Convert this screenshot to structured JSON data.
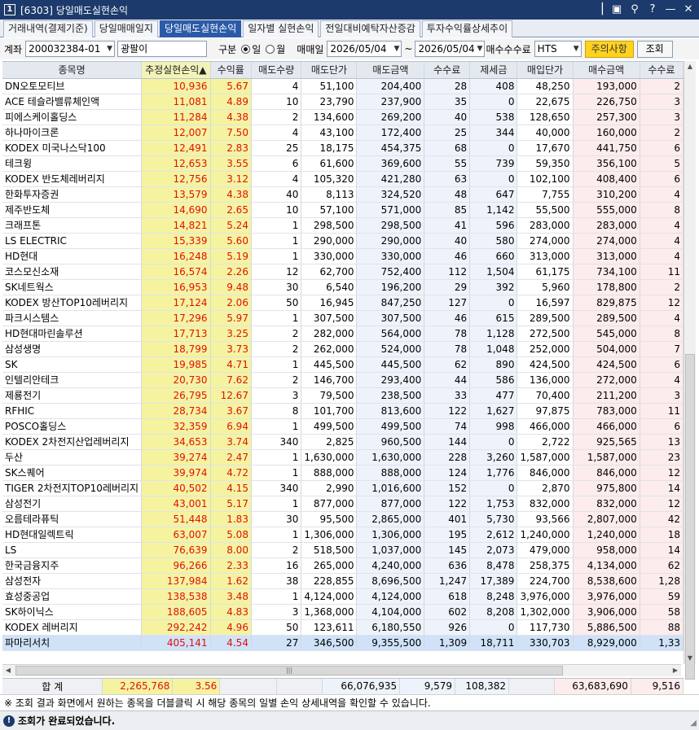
{
  "window": {
    "title": "[6303] 당일매도실현손익",
    "app_icon": "1",
    "controls": [
      "menu-icon",
      "save-icon",
      "filter-icon",
      "help-icon",
      "minimize-icon",
      "close-icon"
    ]
  },
  "tabs": [
    {
      "label": "거래내역(결제기준)",
      "active": false
    },
    {
      "label": "당일매매일지",
      "active": false
    },
    {
      "label": "당일매도실현손익",
      "active": true
    },
    {
      "label": "일자별 실현손익",
      "active": false
    },
    {
      "label": "전일대비예탁자산증감",
      "active": false
    },
    {
      "label": "투자수익률상세추이",
      "active": false
    }
  ],
  "toolbar": {
    "account_label": "계좌",
    "account_value": "200032384-01",
    "account_name": "광팔이",
    "type_label": "구분",
    "radio_day": "일",
    "radio_month": "월",
    "trade_date_label": "매매일",
    "date_from": "2026/05/04",
    "tilde": "~",
    "date_to": "2026/05/04",
    "fee_label": "매수수수료",
    "fee_value": "HTS",
    "notice_button": "주의사항",
    "query_button": "조회"
  },
  "columns": [
    "종목명",
    "추정실현손익▲",
    "수익률",
    "매도수량",
    "매도단가",
    "매도금액",
    "수수료",
    "제세금",
    "매입단가",
    "매수금액",
    "수수료"
  ],
  "rows": [
    [
      "DN오토모티브",
      "10,936",
      "5.67",
      "4",
      "51,100",
      "204,400",
      "28",
      "408",
      "48,250",
      "193,000",
      "2"
    ],
    [
      "ACE 테슬라밸류체인액",
      "11,081",
      "4.89",
      "10",
      "23,790",
      "237,900",
      "35",
      "0",
      "22,675",
      "226,750",
      "3"
    ],
    [
      "피에스케이홀딩스",
      "11,284",
      "4.38",
      "2",
      "134,600",
      "269,200",
      "40",
      "538",
      "128,650",
      "257,300",
      "3"
    ],
    [
      "하나마이크론",
      "12,007",
      "7.50",
      "4",
      "43,100",
      "172,400",
      "25",
      "344",
      "40,000",
      "160,000",
      "2"
    ],
    [
      "KODEX 미국나스닥100",
      "12,491",
      "2.83",
      "25",
      "18,175",
      "454,375",
      "68",
      "0",
      "17,670",
      "441,750",
      "6"
    ],
    [
      "테크윙",
      "12,653",
      "3.55",
      "6",
      "61,600",
      "369,600",
      "55",
      "739",
      "59,350",
      "356,100",
      "5"
    ],
    [
      "KODEX 반도체레버리지",
      "12,756",
      "3.12",
      "4",
      "105,320",
      "421,280",
      "63",
      "0",
      "102,100",
      "408,400",
      "6"
    ],
    [
      "한화투자증권",
      "13,579",
      "4.38",
      "40",
      "8,113",
      "324,520",
      "48",
      "647",
      "7,755",
      "310,200",
      "4"
    ],
    [
      "제주반도체",
      "14,690",
      "2.65",
      "10",
      "57,100",
      "571,000",
      "85",
      "1,142",
      "55,500",
      "555,000",
      "8"
    ],
    [
      "크래프톤",
      "14,821",
      "5.24",
      "1",
      "298,500",
      "298,500",
      "41",
      "596",
      "283,000",
      "283,000",
      "4"
    ],
    [
      "LS ELECTRIC",
      "15,339",
      "5.60",
      "1",
      "290,000",
      "290,000",
      "40",
      "580",
      "274,000",
      "274,000",
      "4"
    ],
    [
      "HD현대",
      "16,248",
      "5.19",
      "1",
      "330,000",
      "330,000",
      "46",
      "660",
      "313,000",
      "313,000",
      "4"
    ],
    [
      "코스모신소재",
      "16,574",
      "2.26",
      "12",
      "62,700",
      "752,400",
      "112",
      "1,504",
      "61,175",
      "734,100",
      "11"
    ],
    [
      "SK네트웍스",
      "16,953",
      "9.48",
      "30",
      "6,540",
      "196,200",
      "29",
      "392",
      "5,960",
      "178,800",
      "2"
    ],
    [
      "KODEX 방산TOP10레버리지",
      "17,124",
      "2.06",
      "50",
      "16,945",
      "847,250",
      "127",
      "0",
      "16,597",
      "829,875",
      "12"
    ],
    [
      "파크시스템스",
      "17,296",
      "5.97",
      "1",
      "307,500",
      "307,500",
      "46",
      "615",
      "289,500",
      "289,500",
      "4"
    ],
    [
      "HD현대마린솔루션",
      "17,713",
      "3.25",
      "2",
      "282,000",
      "564,000",
      "78",
      "1,128",
      "272,500",
      "545,000",
      "8"
    ],
    [
      "삼성생명",
      "18,799",
      "3.73",
      "2",
      "262,000",
      "524,000",
      "78",
      "1,048",
      "252,000",
      "504,000",
      "7"
    ],
    [
      "SK",
      "19,985",
      "4.71",
      "1",
      "445,500",
      "445,500",
      "62",
      "890",
      "424,500",
      "424,500",
      "6"
    ],
    [
      "인텔리안테크",
      "20,730",
      "7.62",
      "2",
      "146,700",
      "293,400",
      "44",
      "586",
      "136,000",
      "272,000",
      "4"
    ],
    [
      "제룡전기",
      "26,795",
      "12.67",
      "3",
      "79,500",
      "238,500",
      "33",
      "477",
      "70,400",
      "211,200",
      "3"
    ],
    [
      "RFHIC",
      "28,734",
      "3.67",
      "8",
      "101,700",
      "813,600",
      "122",
      "1,627",
      "97,875",
      "783,000",
      "11"
    ],
    [
      "POSCO홀딩스",
      "32,359",
      "6.94",
      "1",
      "499,500",
      "499,500",
      "74",
      "998",
      "466,000",
      "466,000",
      "6"
    ],
    [
      "KODEX 2차전지산업레버리지",
      "34,653",
      "3.74",
      "340",
      "2,825",
      "960,500",
      "144",
      "0",
      "2,722",
      "925,565",
      "13"
    ],
    [
      "두산",
      "39,274",
      "2.47",
      "1",
      "1,630,000",
      "1,630,000",
      "228",
      "3,260",
      "1,587,000",
      "1,587,000",
      "23"
    ],
    [
      "SK스퀘어",
      "39,974",
      "4.72",
      "1",
      "888,000",
      "888,000",
      "124",
      "1,776",
      "846,000",
      "846,000",
      "12"
    ],
    [
      "TIGER 2차전지TOP10레버리지",
      "40,502",
      "4.15",
      "340",
      "2,990",
      "1,016,600",
      "152",
      "0",
      "2,870",
      "975,800",
      "14"
    ],
    [
      "삼성전기",
      "43,001",
      "5.17",
      "1",
      "877,000",
      "877,000",
      "122",
      "1,753",
      "832,000",
      "832,000",
      "12"
    ],
    [
      "오름테라퓨틱",
      "51,448",
      "1.83",
      "30",
      "95,500",
      "2,865,000",
      "401",
      "5,730",
      "93,566",
      "2,807,000",
      "42"
    ],
    [
      "HD현대일렉트릭",
      "63,007",
      "5.08",
      "1",
      "1,306,000",
      "1,306,000",
      "195",
      "2,612",
      "1,240,000",
      "1,240,000",
      "18"
    ],
    [
      "LS",
      "76,639",
      "8.00",
      "2",
      "518,500",
      "1,037,000",
      "145",
      "2,073",
      "479,000",
      "958,000",
      "14"
    ],
    [
      "한국금융지주",
      "96,266",
      "2.33",
      "16",
      "265,000",
      "4,240,000",
      "636",
      "8,478",
      "258,375",
      "4,134,000",
      "62"
    ],
    [
      "삼성전자",
      "137,984",
      "1.62",
      "38",
      "228,855",
      "8,696,500",
      "1,247",
      "17,389",
      "224,700",
      "8,538,600",
      "1,28"
    ],
    [
      "효성중공업",
      "138,538",
      "3.48",
      "1",
      "4,124,000",
      "4,124,000",
      "618",
      "8,248",
      "3,976,000",
      "3,976,000",
      "59"
    ],
    [
      "SK하이닉스",
      "188,605",
      "4.83",
      "3",
      "1,368,000",
      "4,104,000",
      "602",
      "8,208",
      "1,302,000",
      "3,906,000",
      "58"
    ],
    [
      "KODEX 레버리지",
      "292,242",
      "4.96",
      "50",
      "123,611",
      "6,180,550",
      "926",
      "0",
      "117,730",
      "5,886,500",
      "88"
    ],
    [
      "파마리서치",
      "405,141",
      "4.54",
      "27",
      "346,500",
      "9,355,500",
      "1,309",
      "18,711",
      "330,703",
      "8,929,000",
      "1,33"
    ]
  ],
  "selected_row": 36,
  "totals": {
    "label": "합 계",
    "pnl": "2,265,768",
    "rate": "3.56",
    "sell_qty": "",
    "sell_price": "",
    "sell_amount": "66,076,935",
    "fee": "9,579",
    "tax": "108,382",
    "buy_price": "",
    "buy_amount": "63,683,690",
    "buy_fee": "9,516"
  },
  "notice": "※ 조회 결과 화면에서 원하는 종목을 더블클릭 시 해당 종목의 일별 손익 상세내역을 확인할 수 있습니다.",
  "status": "조회가 완료되었습니다.",
  "colors": {
    "titlebar": "#1c3a6b",
    "active_tab": "#2b5aa8",
    "pnl_bg": "#f5f3a0",
    "pnl_text": "#e01010",
    "sell_bg": "#eef3fb",
    "buy_bg": "#fdecec",
    "selected_row": "#cfe2f8",
    "notice_button": "#ffd21f"
  }
}
